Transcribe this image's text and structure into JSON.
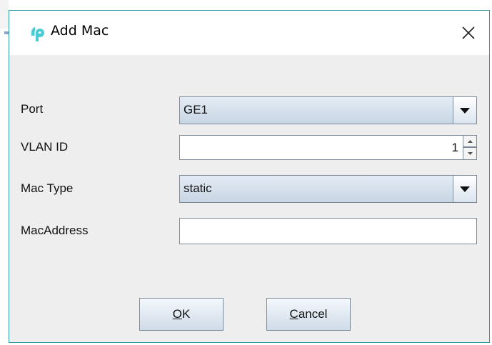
{
  "dialog": {
    "title": "Add Mac",
    "close_icon": "close-icon",
    "app_icon": "tp-link-logo-icon",
    "accent_color": "#2f9c9f"
  },
  "form": {
    "port": {
      "label": "Port",
      "selected": "GE1"
    },
    "vlan_id": {
      "label": "VLAN ID",
      "value": "1"
    },
    "mac_type": {
      "label": "Mac Type",
      "selected": "static"
    },
    "mac_address": {
      "label": "MacAddress",
      "value": ""
    }
  },
  "buttons": {
    "ok": {
      "mnemonic": "O",
      "rest": "K"
    },
    "cancel": {
      "mnemonic": "C",
      "rest": "ancel"
    }
  }
}
